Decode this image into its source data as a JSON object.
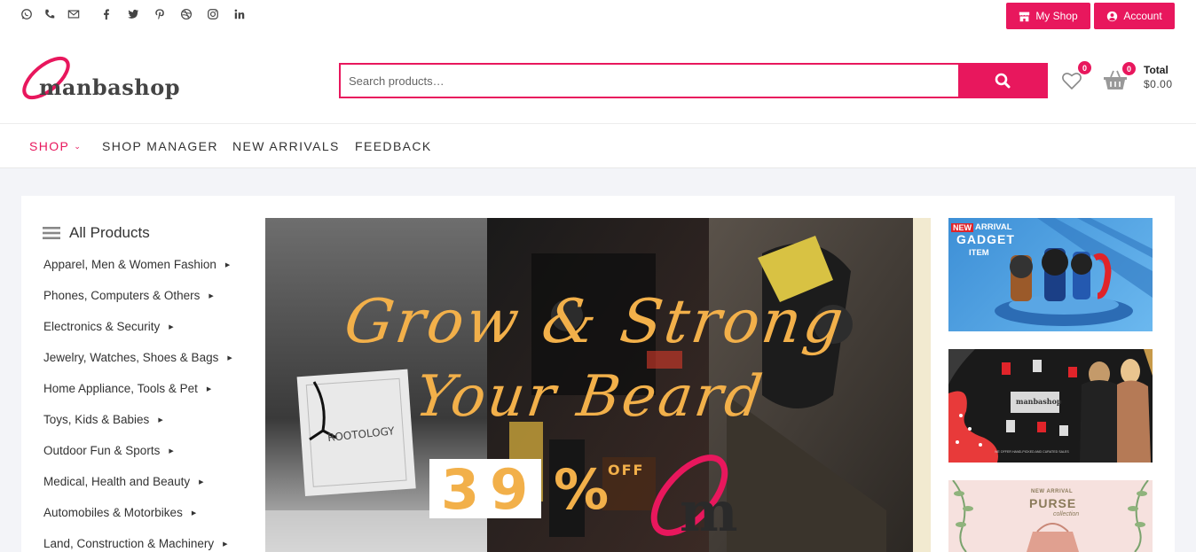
{
  "topbar": {
    "social": [
      "whatsapp-icon",
      "phone-icon",
      "mail-icon",
      "facebook-icon",
      "twitter-icon",
      "pinterest-icon",
      "dribbble-icon",
      "instagram-icon",
      "linkedin-icon"
    ],
    "my_shop_label": "My Shop",
    "account_label": "Account"
  },
  "header": {
    "logo_text": "manbashop",
    "search_placeholder": "Search products…",
    "wishlist_count": "0",
    "cart_count": "0",
    "total_label": "Total",
    "total_value": "$0.00"
  },
  "nav": {
    "items": [
      "SHOP",
      "SHOP MANAGER",
      "NEW ARRIVALS",
      "FEEDBACK"
    ]
  },
  "sidebar": {
    "title": "All Products",
    "categories": [
      "Apparel, Men & Women Fashion",
      "Phones, Computers & Others",
      "Electronics & Security",
      "Jewelry, Watches, Shoes & Bags",
      "Home Appliance, Tools & Pet",
      "Toys, Kids & Babies",
      "Outdoor Fun & Sports",
      "Medical, Health and Beauty",
      "Automobiles & Motorbikes",
      "Land, Construction & Machinery"
    ]
  },
  "banner": {
    "headline_1": "Grow & Strong",
    "headline_2": "Your Beard",
    "discount": "39",
    "percent": "%",
    "off": "OFF",
    "box_label": "ROOTOLOGY",
    "logo_letter": "m"
  },
  "side_banners": {
    "one": {
      "tag": "NEW",
      "line1": "ARRIVAL",
      "line2": "GADGET",
      "line3": "ITEM"
    },
    "two": {
      "logo": "manbashop",
      "caption": "WE OFFER HAND-PICKED AND CURATED SALES"
    },
    "three": {
      "line1": "NEW ARRIVAL",
      "line2": "PURSE",
      "line3": "collection"
    }
  },
  "colors": {
    "accent": "#e8175d",
    "banner_text": "#f2b04a"
  }
}
